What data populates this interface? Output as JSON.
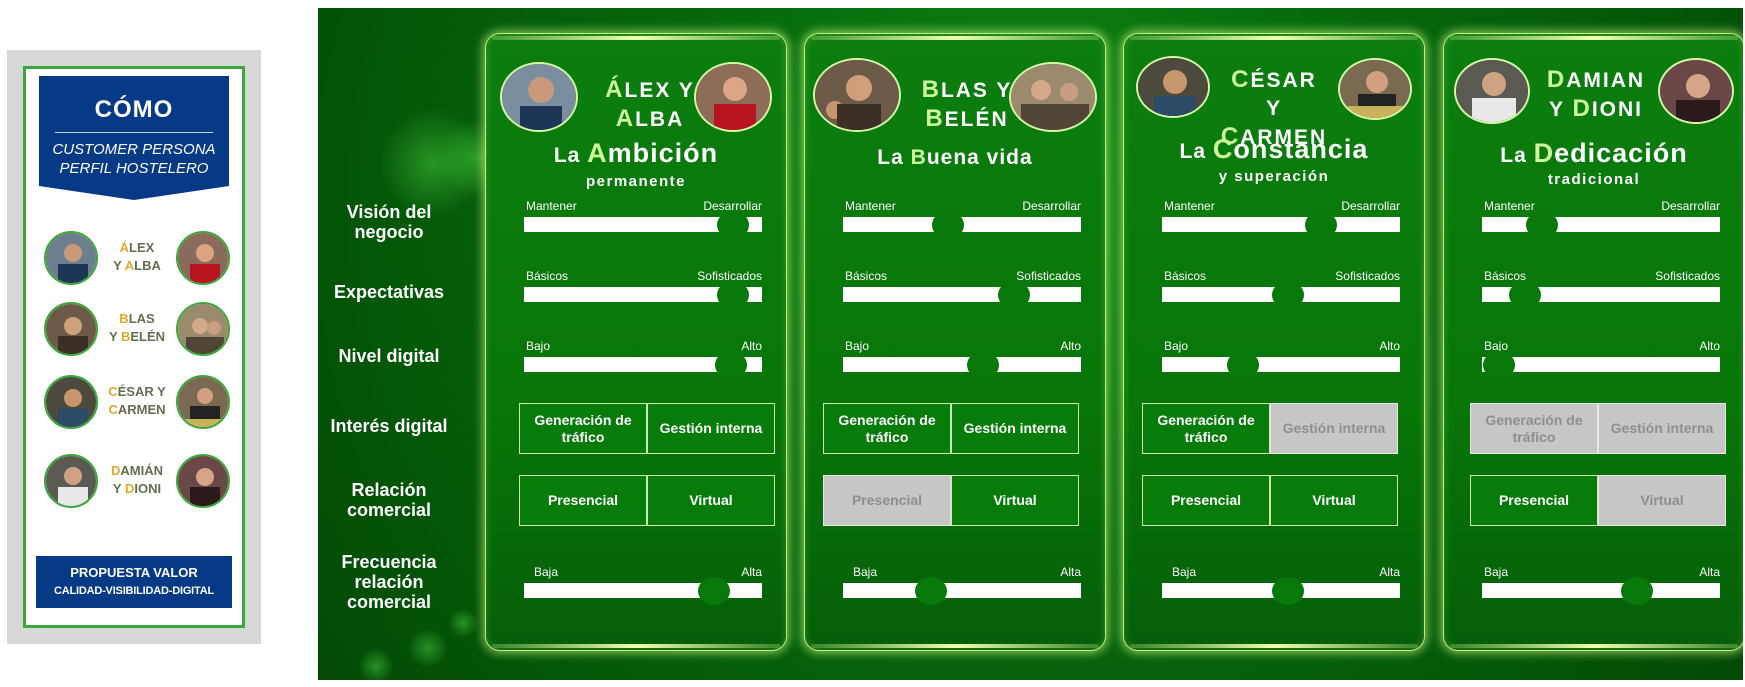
{
  "thumbnail": {
    "title": "CÓMO",
    "subtitle_line1": "CUSTOMER PERSONA",
    "subtitle_line2": "PERFIL HOSTELERO",
    "rows": [
      {
        "first_initial": "Á",
        "first_rest": "LEX",
        "second_prefix": "Y ",
        "second_initial": "A",
        "second_rest": "LBA"
      },
      {
        "first_initial": "B",
        "first_rest": "LAS",
        "second_prefix": "Y ",
        "second_initial": "B",
        "second_rest": "ELÉN"
      },
      {
        "first_initial": "C",
        "first_rest": "ÉSAR Y",
        "second_prefix": "",
        "second_initial": "C",
        "second_rest": "ARMEN"
      },
      {
        "first_initial": "D",
        "first_rest": "AMIÁN",
        "second_prefix": "Y ",
        "second_initial": "D",
        "second_rest": "IONI"
      }
    ],
    "footer_line1": "PROPUESTA VALOR",
    "footer_line2": "CALIDAD-VISIBILIDAD-DIGITAL"
  },
  "row_labels": {
    "vision": "Visión del negocio",
    "expectativas": "Expectativas",
    "nivel": "Nivel digital",
    "interes": "Interés digital",
    "relacion": "Relación comercial",
    "frecuencia": "Frecuencia relación comercial"
  },
  "slider_labels": {
    "vision": {
      "left": "Mantener",
      "right": "Desarrollar"
    },
    "expectativas": {
      "left": "Básicos",
      "right": "Sofisticados"
    },
    "nivel": {
      "left": "Bajo",
      "right": "Alto"
    },
    "frecuencia": {
      "left": "Baja",
      "right": "Alta"
    }
  },
  "option_labels": {
    "generacion": "Generación de tráfico",
    "gestion": "Gestión interna",
    "presencial": "Presencial",
    "virtual": "Virtual"
  },
  "colors": {
    "panel": "#066a0b",
    "accent": "#cdfb9a",
    "option_on": "#087c0a",
    "option_off": "#c6c6c6",
    "thumb_blue": "#063a86",
    "thumb_green": "#3ca83a"
  },
  "personas": [
    {
      "name1_initial": "Á",
      "name1_rest": "LEX Y",
      "name2_initial": "A",
      "name2_rest": "LBA",
      "tag_prefix": "La ",
      "tag_initial": "A",
      "tag_rest": "mbición",
      "tag_sub": "permanente",
      "sliders": {
        "vision": 0.88,
        "expectativas": 0.88,
        "nivel": 0.87,
        "frecuencia": 0.8
      },
      "interes": {
        "generacion": true,
        "gestion": true
      },
      "relacion": {
        "presencial": true,
        "virtual": true
      }
    },
    {
      "name1_initial": "B",
      "name1_rest": "LAS Y",
      "name2_initial": "B",
      "name2_rest": "ELÉN",
      "tag_prefix": "La ",
      "tag_initial": "B",
      "tag_rest": "uena vida",
      "tag_sub": "",
      "sliders": {
        "vision": 0.44,
        "expectativas": 0.72,
        "nivel": 0.59,
        "frecuencia": 0.37
      },
      "interes": {
        "generacion": true,
        "gestion": true
      },
      "relacion": {
        "presencial": false,
        "virtual": true
      }
    },
    {
      "name1_initial": "C",
      "name1_rest": "ÉSAR",
      "name2_initial": "C",
      "name2_rest": "ARMEN",
      "tag_prefix": "La ",
      "tag_initial": "C",
      "tag_rest": "onstancia",
      "tag_sub": "y superación",
      "sliders": {
        "vision": 0.67,
        "expectativas": 0.53,
        "nivel": 0.34,
        "frecuencia": 0.53
      },
      "interes": {
        "generacion": true,
        "gestion": false
      },
      "relacion": {
        "presencial": true,
        "virtual": true
      }
    },
    {
      "name1_initial": "D",
      "name1_rest": "AMIAN",
      "name2_initial": "D",
      "name2_rest": "IONI",
      "tag_prefix": "La ",
      "tag_initial": "D",
      "tag_rest": "edicación",
      "tag_sub": "tradicional",
      "sliders": {
        "vision": 0.25,
        "expectativas": 0.18,
        "nivel": 0.07,
        "frecuencia": 0.65
      },
      "interes": {
        "generacion": false,
        "gestion": false
      },
      "relacion": {
        "presencial": true,
        "virtual": false
      }
    }
  ]
}
